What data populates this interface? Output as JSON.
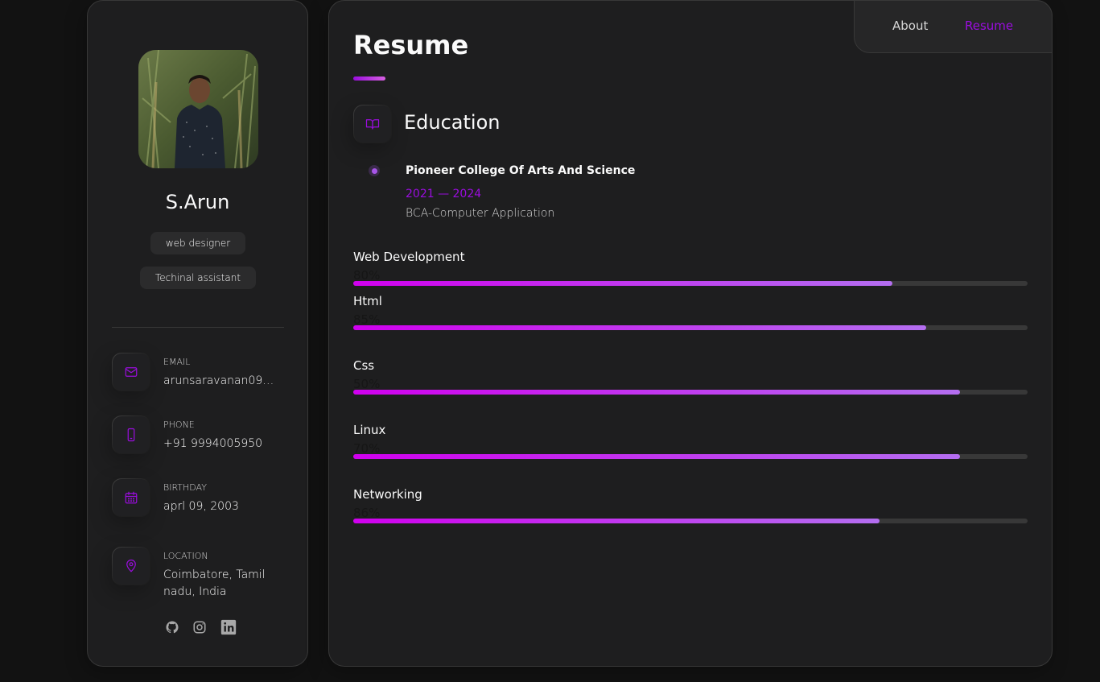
{
  "profile": {
    "name": "S.Arun",
    "titles": [
      "web designer",
      "Techinal assistant"
    ]
  },
  "contacts": [
    {
      "label": "EMAIL",
      "value": "arunsaravanan090...",
      "icon": "mail-icon"
    },
    {
      "label": "PHONE",
      "value": "+91 9994005950",
      "icon": "phone-icon"
    },
    {
      "label": "BIRTHDAY",
      "value": "aprl 09, 2003",
      "icon": "calendar-icon"
    },
    {
      "label": "LOCATION",
      "value": "Coimbatore, Tamil nadu, India",
      "icon": "location-pin-icon"
    }
  ],
  "socials": [
    "github-icon",
    "instagram-icon",
    "linkedin-icon"
  ],
  "nav": {
    "about": "About",
    "resume": "Resume",
    "active": "resume"
  },
  "article": {
    "title": "Resume"
  },
  "education": {
    "section_title": "Education",
    "items": [
      {
        "school": "Pioneer College Of Arts And Science",
        "years": "2021 — 2024",
        "degree": "BCA-Computer Application"
      }
    ]
  },
  "skills": [
    {
      "name": "Web Development",
      "value_label": "80%",
      "fill_fraction": 0.8
    },
    {
      "name": "Html",
      "value_label": "85%",
      "fill_fraction": 0.85
    },
    {
      "name": "Css",
      "value_label": "50%",
      "fill_fraction": 0.9
    },
    {
      "name": "Linux",
      "value_label": "70%",
      "fill_fraction": 0.9
    },
    {
      "name": "Networking",
      "value_label": "86%",
      "fill_fraction": 0.78
    }
  ],
  "colors": {
    "accent": "#9a0dde",
    "background": "#121212",
    "card": "#1e1e1f"
  }
}
